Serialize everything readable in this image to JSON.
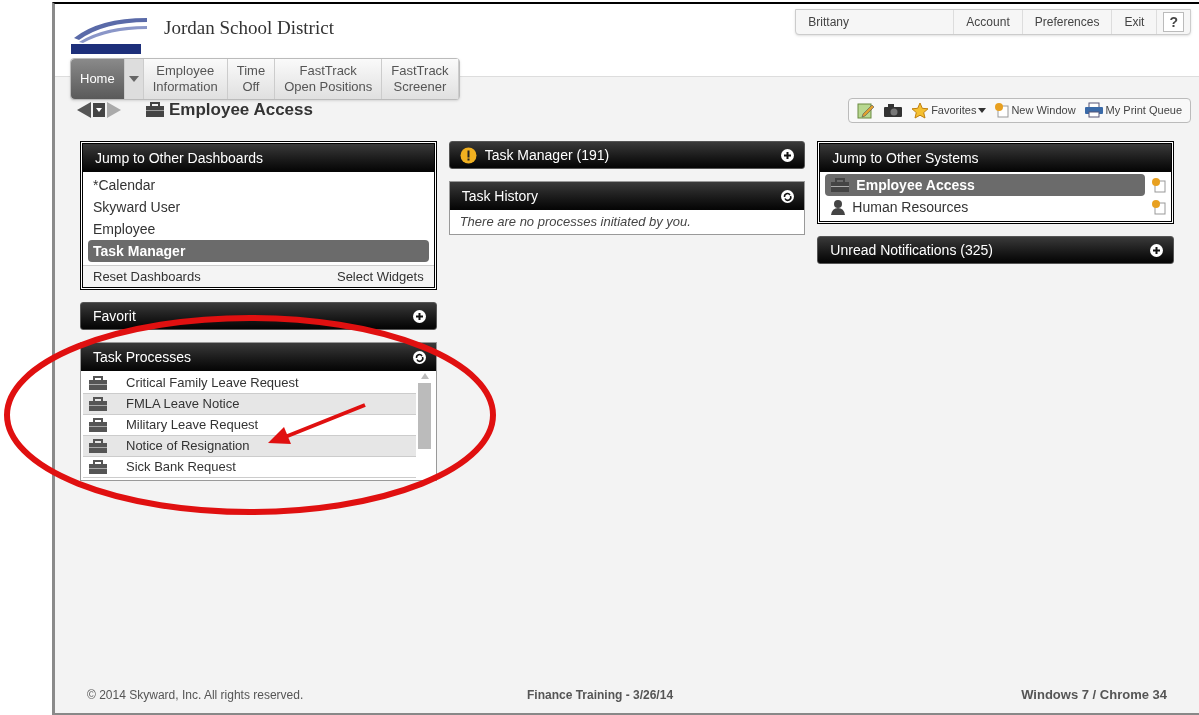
{
  "header": {
    "district": "Jordan School District",
    "user_menu": [
      "Brittany",
      "Account",
      "Preferences",
      "Exit",
      "?"
    ],
    "nav_tabs": [
      {
        "label": "Home",
        "selected": true
      },
      {
        "label": "Employee\nInformation",
        "selected": false
      },
      {
        "label": "Time\nOff",
        "selected": false
      },
      {
        "label": "FastTrack\nOpen Positions",
        "selected": false
      },
      {
        "label": "FastTrack\nScreener",
        "selected": false
      }
    ]
  },
  "page_title": "Employee Access",
  "toolbar": [
    {
      "kind": "notes"
    },
    {
      "kind": "camera"
    },
    {
      "kind": "favorites",
      "label": "Favorites"
    },
    {
      "kind": "window",
      "label": "New Window"
    },
    {
      "kind": "printer",
      "label": "My Print Queue"
    }
  ],
  "columns": [
    [
      {
        "kind": "list",
        "title": "Jump to Other Dashboards",
        "items": [
          {
            "label": "*Calendar",
            "selected": false
          },
          {
            "label": "Skyward User",
            "selected": false
          },
          {
            "label": "Employee",
            "selected": false
          },
          {
            "label": "Task Manager",
            "selected": true
          }
        ],
        "footer": [
          "Reset Dashboards",
          "Select Widgets"
        ]
      },
      {
        "kind": "collapsed",
        "title": "Favorit"
      },
      {
        "kind": "tasks",
        "title": "Task Processes",
        "items": [
          "Critical Family Leave Request",
          "FMLA Leave Notice",
          "Military Leave Request",
          "Notice of Resignation",
          "Sick Bank Request"
        ]
      }
    ],
    [
      {
        "kind": "alert",
        "title": "Task Manager (191)"
      },
      {
        "kind": "message",
        "title": "Task History",
        "message": "There are no processes initiated by you."
      }
    ],
    [
      {
        "kind": "systems",
        "title": "Jump to Other Systems",
        "items": [
          {
            "label": "Employee Access",
            "selected": true
          },
          {
            "label": "Human Resources",
            "selected": false
          }
        ]
      },
      {
        "kind": "collapsed",
        "title": "Unread Notifications (325)"
      }
    ]
  ],
  "footer": {
    "copyright": "© 2014 Skyward, Inc. All rights reserved.",
    "center": "Finance Training - 3/26/14",
    "right": "Windows 7 / Chrome 34"
  }
}
